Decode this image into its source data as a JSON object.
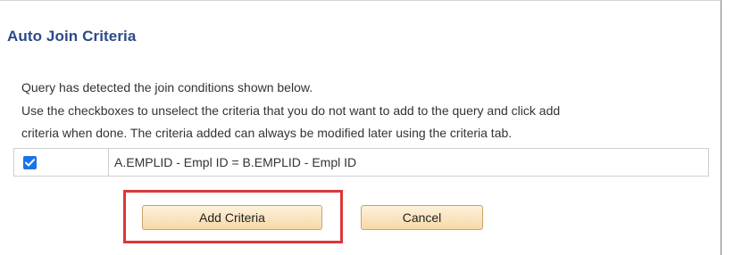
{
  "dialog": {
    "title": "Auto Join Criteria",
    "line1": "Query has detected the join conditions shown below.",
    "line2": "Use the checkboxes to unselect the criteria that you do not want to add to the query and click add",
    "line3": "criteria when done. The criteria added can always be modified later using the criteria tab."
  },
  "criteria": [
    {
      "checked": true,
      "text": "A.EMPLID - Empl ID = B.EMPLID - Empl ID"
    }
  ],
  "buttons": {
    "add_criteria": "Add Criteria",
    "cancel": "Cancel"
  },
  "colors": {
    "title": "#2c4a8a",
    "checkbox": "#1a73e8",
    "button_bg": "#f6d9a6",
    "highlight": "#d9383a"
  },
  "icons": {
    "checkbox_checked": "checkmark-icon"
  }
}
